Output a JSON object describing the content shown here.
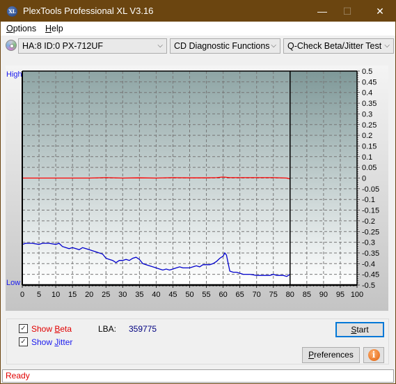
{
  "window": {
    "title": "PlexTools Professional XL V3.16",
    "app_icon_text": "XL",
    "minimize_icon": "—",
    "maximize_icon": "☐",
    "close_icon": "✕"
  },
  "menu": {
    "items": [
      {
        "label_ul": "O",
        "label_rest": "ptions"
      },
      {
        "label_ul": "H",
        "label_rest": "elp"
      }
    ]
  },
  "toolbar": {
    "drive_select": "HA:8 ID:0  PX-712UF",
    "function_select": "CD Diagnostic Functions",
    "test_select": "Q-Check Beta/Jitter Test",
    "chevron": "⌵"
  },
  "chart_labels": {
    "high": "High",
    "low": "Low"
  },
  "chart_data": {
    "type": "line",
    "title": "",
    "xlabel": "",
    "ylabel": "",
    "xlim": [
      0,
      100
    ],
    "ylim": [
      -0.5,
      0.5
    ],
    "x_ticks": [
      0,
      5,
      10,
      15,
      20,
      25,
      30,
      35,
      40,
      45,
      50,
      55,
      60,
      65,
      70,
      75,
      80,
      85,
      90,
      95,
      100
    ],
    "y_ticks": [
      0.5,
      0.45,
      0.4,
      0.35,
      0.3,
      0.25,
      0.2,
      0.15,
      0.1,
      0.05,
      0,
      -0.05,
      -0.1,
      -0.15,
      -0.2,
      -0.25,
      -0.3,
      -0.35,
      -0.4,
      -0.45,
      -0.5
    ],
    "y_tick_labels": [
      "0.5",
      "0.45",
      "0.4",
      "0.35",
      "0.3",
      "0.25",
      "0.2",
      "0.15",
      "0.1",
      "0.05",
      "0",
      "-0.05",
      "-0.1",
      "-0.15",
      "-0.2",
      "-0.25",
      "-0.3",
      "-0.35",
      "-0.4",
      "-0.45",
      "-0.5"
    ],
    "grid": true,
    "progress_marker_x": 80,
    "series": [
      {
        "name": "Beta",
        "color": "#ff0000",
        "x": [
          0,
          10,
          20,
          25,
          30,
          35,
          40,
          45,
          50,
          55,
          58,
          60,
          62,
          65,
          70,
          75,
          79,
          80
        ],
        "values": [
          0.0,
          0.0,
          0.0,
          0.002,
          0.0,
          0.001,
          0.0,
          0.002,
          0.001,
          0.001,
          0.002,
          0.005,
          0.002,
          0.002,
          0.002,
          0.002,
          0.0,
          -0.004
        ]
      },
      {
        "name": "Jitter",
        "color": "#0000cc",
        "x": [
          0,
          1,
          3,
          5,
          6,
          8,
          10,
          11,
          12,
          14,
          15,
          16,
          17,
          18,
          19,
          20,
          22,
          24,
          25,
          26,
          27,
          28,
          29,
          30,
          31,
          32,
          33,
          34,
          35,
          36,
          38,
          40,
          41,
          42,
          43,
          44,
          45,
          46,
          47,
          48,
          50,
          51,
          52,
          53,
          54,
          55,
          56,
          57,
          58,
          59,
          60,
          60.5,
          61,
          62,
          63,
          64,
          65,
          66,
          68,
          70,
          72,
          74,
          75,
          76,
          77,
          78,
          79,
          80
        ],
        "values": [
          -0.31,
          -0.305,
          -0.305,
          -0.31,
          -0.305,
          -0.305,
          -0.31,
          -0.305,
          -0.32,
          -0.33,
          -0.325,
          -0.33,
          -0.335,
          -0.325,
          -0.33,
          -0.335,
          -0.345,
          -0.355,
          -0.375,
          -0.38,
          -0.385,
          -0.395,
          -0.385,
          -0.385,
          -0.38,
          -0.385,
          -0.375,
          -0.37,
          -0.38,
          -0.4,
          -0.41,
          -0.42,
          -0.425,
          -0.43,
          -0.425,
          -0.43,
          -0.425,
          -0.42,
          -0.415,
          -0.42,
          -0.42,
          -0.415,
          -0.41,
          -0.415,
          -0.405,
          -0.405,
          -0.405,
          -0.4,
          -0.39,
          -0.375,
          -0.365,
          -0.35,
          -0.36,
          -0.435,
          -0.44,
          -0.44,
          -0.445,
          -0.45,
          -0.45,
          -0.455,
          -0.455,
          -0.455,
          -0.45,
          -0.455,
          -0.455,
          -0.455,
          -0.46,
          -0.45
        ]
      }
    ]
  },
  "bottom": {
    "show_beta_pre": "Show ",
    "show_beta_ul": "B",
    "show_beta_post": "eta",
    "show_beta_checked": true,
    "show_jitter_pre": "Show ",
    "show_jitter_ul": "J",
    "show_jitter_post": "itter",
    "show_jitter_checked": true,
    "lba_label": "LBA:",
    "lba_value": "359775",
    "start_ul": "S",
    "start_rest": "tart",
    "preferences_ul": "P",
    "preferences_rest": "references",
    "info_icon": "i",
    "check_mark": "✓"
  },
  "status": {
    "text": "Ready"
  }
}
